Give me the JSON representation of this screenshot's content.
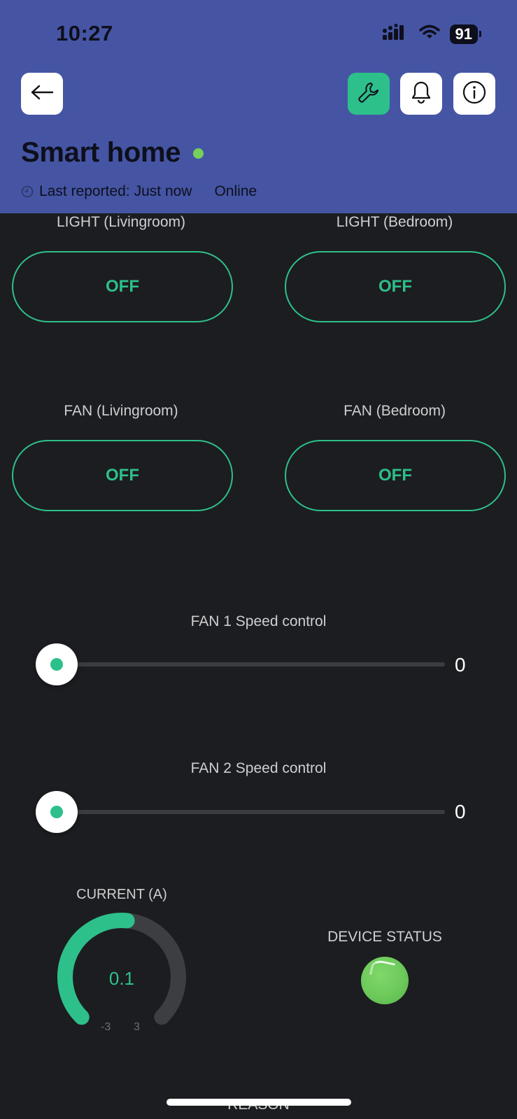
{
  "status_bar": {
    "time": "10:27",
    "battery": "91"
  },
  "header": {
    "title": "Smart home",
    "last_reported_label": "Last reported:",
    "last_reported_value": "Just now",
    "status": "Online",
    "icons": {
      "back": "arrow-left-icon",
      "settings": "wrench-icon",
      "notifications": "bell-icon",
      "info": "info-icon"
    },
    "colors": {
      "header_bg": "#4555a4",
      "accent": "#2dc08a",
      "online": "#76d05a"
    }
  },
  "switches": [
    {
      "label": "LIGHT (Livingroom)",
      "state": "OFF"
    },
    {
      "label": "LIGHT (Bedroom)",
      "state": "OFF"
    },
    {
      "label": "FAN (Livingroom)",
      "state": "OFF"
    },
    {
      "label": "FAN (Bedroom)",
      "state": "OFF"
    }
  ],
  "sliders": [
    {
      "label": "FAN 1 Speed control",
      "value": "0"
    },
    {
      "label": "FAN 2 Speed control",
      "value": "0"
    }
  ],
  "gauge": {
    "label": "CURRENT (A)",
    "value": "0.1",
    "min": "-3",
    "max": "3",
    "value_fraction": 0.52
  },
  "device_status": {
    "label": "DEVICE STATUS",
    "color": "#6cc95a"
  },
  "next_section": {
    "label": "REASON"
  }
}
